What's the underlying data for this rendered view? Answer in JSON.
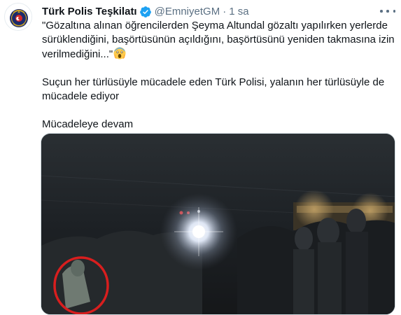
{
  "tweet": {
    "display_name": "Türk Polis Teşkilatı",
    "handle": "@EmniyetGM",
    "separator": "·",
    "timestamp": "1 sa",
    "avatar_icon": "police-badge-icon",
    "verified_icon": "verified-badge-icon",
    "more_icon": "more-options-icon",
    "verified_color": "#1da1f2",
    "text": {
      "para1_line1": "\"Gözaltına alınan öğrencilerden Şeyma Altundal gözaltı yapılırken yerlerde",
      "para1_line2": "sürüklendiğini, başörtüsünün açıldığını, başörtüsünü yeniden takmasına izin",
      "para1_line3": "verilmediğini...\"",
      "para1_emoji": "😱",
      "para2_line1": "Suçun her türlüsüyle mücadele eden Türk Polisi, yalanın her türlüsüyle de",
      "para2_line2": "mücadele ediyor",
      "para3": "Mücadeleye devam"
    },
    "media": {
      "kind": "night-street-video-still",
      "highlight_color": "#d81e1e"
    }
  }
}
